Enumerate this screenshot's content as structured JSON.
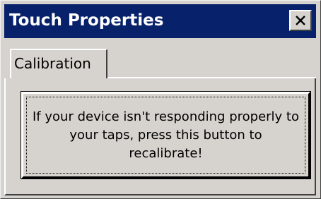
{
  "window": {
    "title": "Touch Properties"
  },
  "tabs": [
    {
      "label": "Calibration"
    }
  ],
  "calibration": {
    "button_text": "If your device isn't responding properly to your taps, press this button to recalibrate!"
  },
  "colors": {
    "title_bar": "#08216b",
    "face": "#d6d3ce",
    "title_text": "#ffffff"
  },
  "icons": {
    "close": "close-icon"
  }
}
